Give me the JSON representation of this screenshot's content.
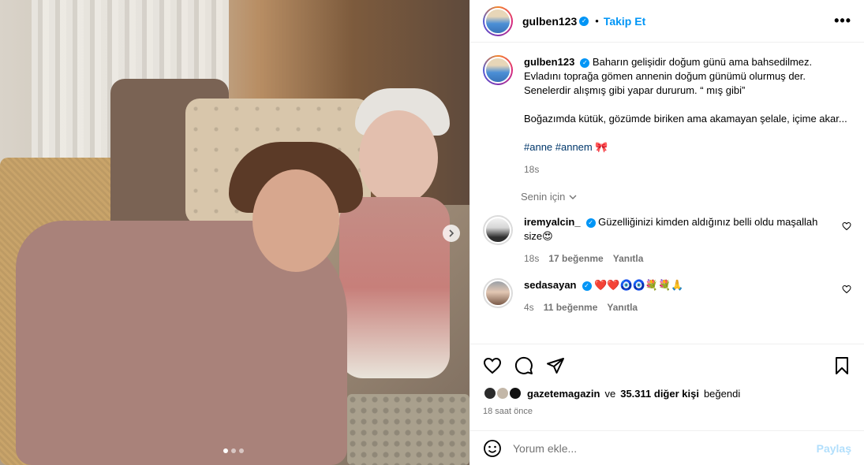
{
  "post": {
    "author": "gulben123",
    "follow_label": "Takip Et",
    "separator": "•",
    "more_label": "•••",
    "caption": "Baharın gelişidir doğum günü ama bahsedilmez. Evladını toprağa gömen annenin doğum günümü olurmuş der. Senelerdir alışmış gibi yapar dururum. “ mış gibi”\n\nBoğazımda kütük, gözümde biriken ama akamayan şelale, içime akar...",
    "hashtags": "#anne #annem",
    "hashtag_emoji": "🎀",
    "caption_time": "18s",
    "for_you_label": "Senin için",
    "verified_mark": "✓"
  },
  "comments": [
    {
      "username": "iremyalcin_",
      "text": "Güzelliğinizi kimden aldığınız belli oldu maşallah size😍",
      "time": "18s",
      "likes": "17 beğenme",
      "reply": "Yanıtla"
    },
    {
      "username": "sedasayan",
      "text": "❤️❤️🧿🧿💐💐🙏",
      "time": "4s",
      "likes": "11 beğenme",
      "reply": "Yanıtla"
    }
  ],
  "likes": {
    "first_user": "gazetemagazin",
    "connector": "ve",
    "others": "35.311 diğer kişi",
    "suffix": "beğendi",
    "time_ago": "18 saat önce"
  },
  "add_comment": {
    "placeholder": "Yorum ekle...",
    "post_label": "Paylaş"
  },
  "icons": {
    "like": "heart-icon",
    "comment": "comment-icon",
    "share": "share-icon",
    "save": "bookmark-icon",
    "emoji": "emoji-icon",
    "next": "chevron-right-icon"
  },
  "carousel": {
    "count": 3,
    "active": 0
  },
  "colors": {
    "link": "#0095f6",
    "muted": "#737373",
    "hashtag": "#00376b"
  }
}
